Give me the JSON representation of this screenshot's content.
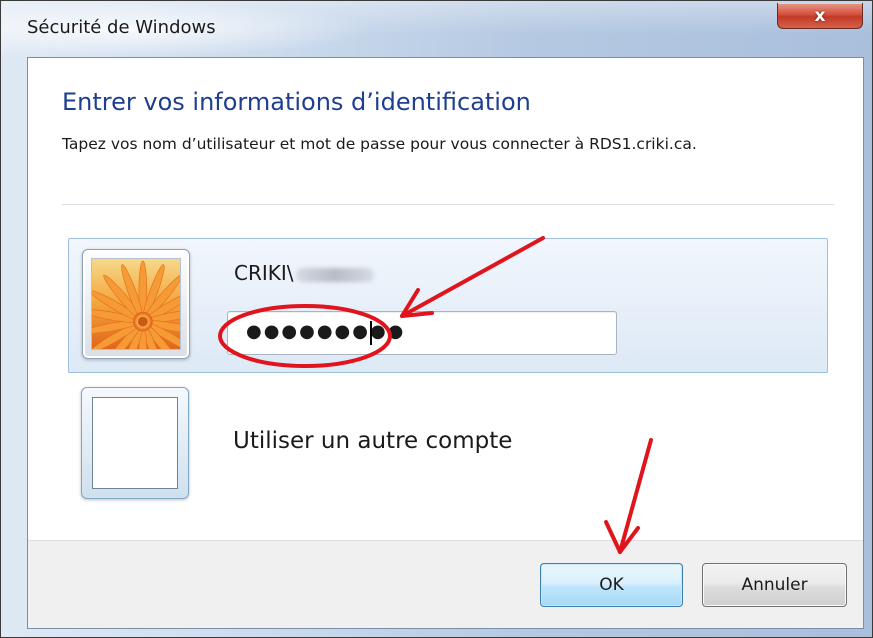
{
  "window": {
    "title": "Sécurité de Windows",
    "close_glyph": "x"
  },
  "dialog": {
    "heading": "Entrer vos informations d’identification",
    "description": "Tapez vos nom d’utilisateur et mot de passe pour vous connecter à RDS1.criki.ca."
  },
  "credential": {
    "username": "CRIKI\\",
    "password_mask": "●●●●●●●●●"
  },
  "other_account": {
    "label": "Utiliser un autre compte"
  },
  "buttons": {
    "ok": "OK",
    "cancel": "Annuler"
  },
  "colors": {
    "heading": "#1e3f8f",
    "annotation": "#e0141c",
    "ok_border": "#3c7fb1"
  },
  "icons": {
    "avatar": "orange-flower-icon",
    "other_account": "blank-user-icon",
    "close": "close-icon"
  }
}
